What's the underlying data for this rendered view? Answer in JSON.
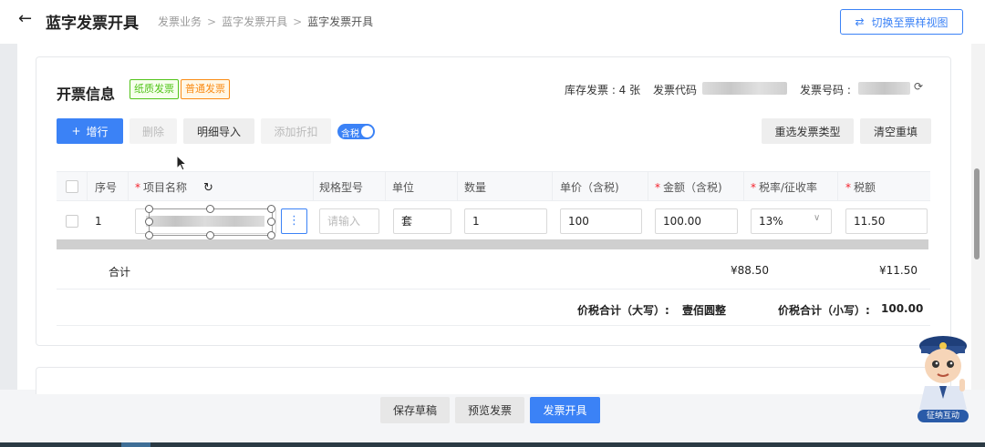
{
  "header": {
    "back_icon": "arrow-left-icon",
    "title": "蓝字发票开具",
    "breadcrumb": [
      "发票业务",
      "蓝字发票开具",
      "蓝字发票开具"
    ],
    "breadcrumb_sep": ">",
    "switch_view_icon": "swap-icon",
    "switch_view_label": "切换至票样视图"
  },
  "section": {
    "title": "开票信息",
    "tag_paper": "纸质发票",
    "tag_normal": "普通发票",
    "stock_info": "库存发票 : 4 张",
    "invoice_code_label": "发票代码",
    "invoice_number_label": "发票号码 :",
    "refresh_icon": "refresh-icon"
  },
  "toolbar": {
    "add_row_icon": "plus-icon",
    "add_row": "增行",
    "delete": "删除",
    "import_detail": "明细导入",
    "add_discount": "添加折扣",
    "tax_inclusive_toggle": "含税",
    "tax_inclusive_on": true,
    "reselect_type": "重选发票类型",
    "clear_refill": "清空重填"
  },
  "table": {
    "columns": [
      {
        "label": "序号",
        "required": false
      },
      {
        "label": "项目名称",
        "required": true
      },
      {
        "label": "规格型号",
        "required": false
      },
      {
        "label": "单位",
        "required": false
      },
      {
        "label": "数量",
        "required": false
      },
      {
        "label": "单价（含税)",
        "required": false
      },
      {
        "label": "金额（含税)",
        "required": true
      },
      {
        "label": "税率/征收率",
        "required": true
      },
      {
        "label": "税额",
        "required": true
      }
    ],
    "required_mark": "*",
    "rows": [
      {
        "index": "1",
        "spec_placeholder": "请输入",
        "unit": "套",
        "quantity": "1",
        "unit_price": "100",
        "amount": "100.00",
        "tax_rate": "13%",
        "tax_amount": "11.50"
      }
    ],
    "more_icon": "more-vertical-icon",
    "dropdown_icon": "chevron-down-icon",
    "subtotal_label": "合计",
    "subtotal_amount": "¥88.50",
    "subtotal_tax": "¥11.50",
    "total_upper_label": "价税合计（大写）:",
    "total_upper_value": "壹佰圆整",
    "total_lower_label": "价税合计（小写）:",
    "total_lower_value": "100.00"
  },
  "footer": {
    "save_draft": "保存草稿",
    "preview": "预览发票",
    "issue": "发票开具"
  },
  "assistant": {
    "label": "征纳互动",
    "avatar_icon": "tax-officer-mascot-icon"
  },
  "colors": {
    "primary": "#3b82f6",
    "tag_green": "#52c41a",
    "tag_orange": "#fa8c16",
    "required": "#f5222d"
  }
}
